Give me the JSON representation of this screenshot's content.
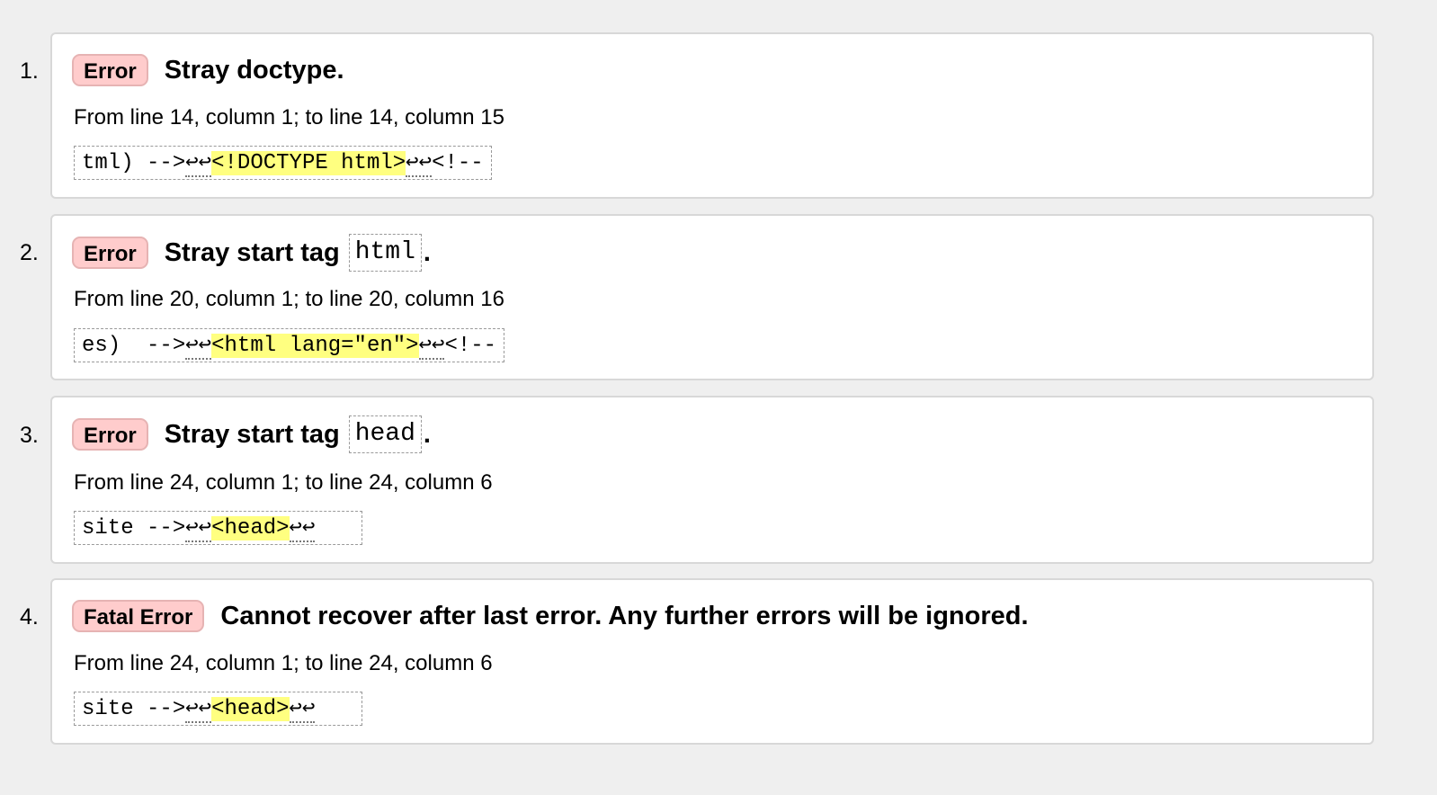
{
  "errors": [
    {
      "number": "1.",
      "type": "Error",
      "message": "Stray doctype.",
      "message_code": "",
      "message_after": "",
      "location": "From line 14, column 1; to line 14, column 15",
      "extract": {
        "before": "tml) -->",
        "lf_before": "↩↩",
        "highlight": "<!DOCTYPE html>",
        "lf_after": "↩↩",
        "after": "<!--"
      }
    },
    {
      "number": "2.",
      "type": "Error",
      "message": "Stray start tag",
      "message_code": "html",
      "message_after": ".",
      "location": "From line 20, column 1; to line 20, column 16",
      "extract": {
        "before": "es)  -->",
        "lf_before": "↩↩",
        "highlight": "<html lang=\"en\">",
        "lf_after": "↩↩",
        "after": "<!--"
      }
    },
    {
      "number": "3.",
      "type": "Error",
      "message": "Stray start tag",
      "message_code": "head",
      "message_after": ".",
      "location": "From line 24, column 1; to line 24, column 6",
      "extract": {
        "before": "site -->",
        "lf_before": "↩↩",
        "highlight": "<head>",
        "lf_after": "↩↩",
        "after": "   "
      }
    },
    {
      "number": "4.",
      "type": "Fatal Error",
      "message": "Cannot recover after last error. Any further errors will be ignored.",
      "message_code": "",
      "message_after": "",
      "location": "From line 24, column 1; to line 24, column 6",
      "extract": {
        "before": "site -->",
        "lf_before": "↩↩",
        "highlight": "<head>",
        "lf_after": "↩↩",
        "after": "   "
      }
    }
  ],
  "colors": {
    "page_bg": "#efefef",
    "card_bg": "#ffffff",
    "error_badge_bg": "#ffcccc",
    "highlight_bg": "#ffff80"
  }
}
